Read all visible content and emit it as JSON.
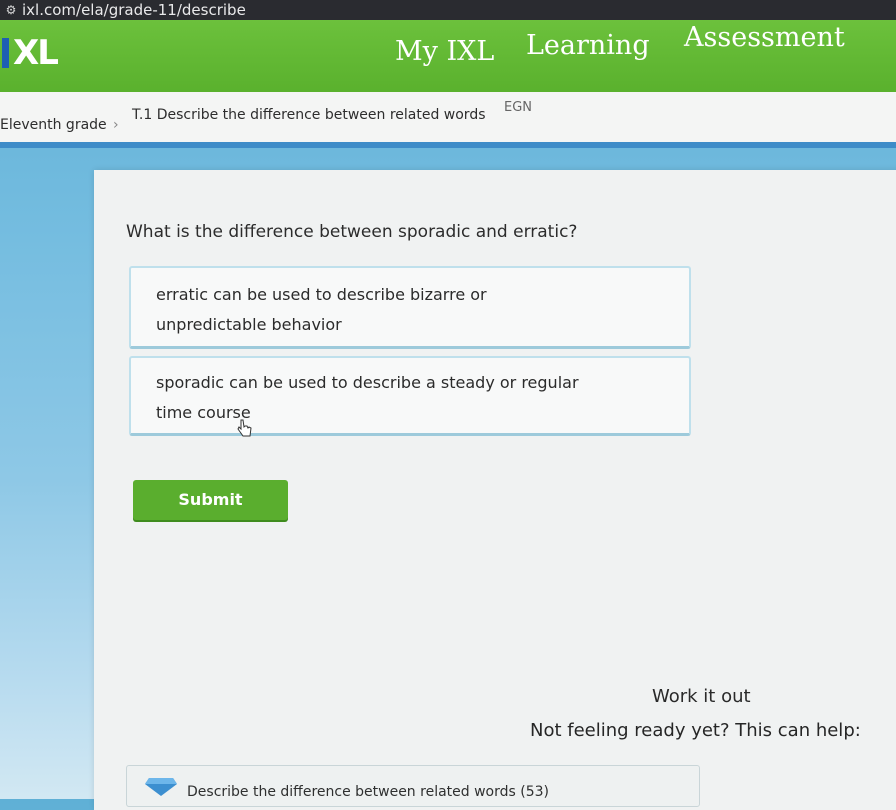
{
  "browser": {
    "url": "ixl.com/ela/grade-11/describe"
  },
  "nav": {
    "logo_text": "XL",
    "items": [
      "My IXL",
      "Learning",
      "Assessment"
    ]
  },
  "breadcrumb": {
    "grade": "Eleventh grade",
    "skill": "T.1 Describe the difference between related words",
    "code": "EGN"
  },
  "question": {
    "prompt": "What is the difference between sporadic and erratic?",
    "choices": [
      {
        "line1": "erratic can be used to describe bizarre or",
        "line2": "unpredictable behavior"
      },
      {
        "line1": "sporadic can be used to describe a steady or regular",
        "line2": "time course"
      }
    ],
    "submit_label": "Submit"
  },
  "help": {
    "work_it_out": "Work it out",
    "not_ready": "Not feeling ready yet? This can help:",
    "lesson": "Describe the difference between related words (53)"
  },
  "colors": {
    "nav_green": "#5ab12d",
    "submit_green": "#5aae2e",
    "accent_blue": "#3e8cc8"
  }
}
